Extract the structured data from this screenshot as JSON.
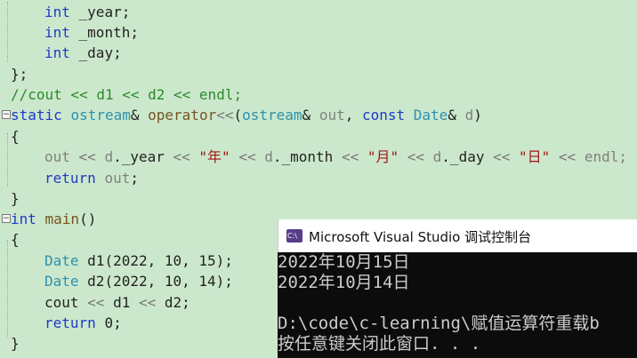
{
  "editor": {
    "lines": [
      {
        "id": "l1",
        "tokens": [
          {
            "c": "kw",
            "t": "int"
          },
          {
            "c": "pl",
            "t": " _year;"
          }
        ]
      },
      {
        "id": "l2",
        "tokens": [
          {
            "c": "kw",
            "t": "int"
          },
          {
            "c": "pl",
            "t": " _month;"
          }
        ]
      },
      {
        "id": "l3",
        "tokens": [
          {
            "c": "kw",
            "t": "int"
          },
          {
            "c": "pl",
            "t": " _day;"
          }
        ]
      },
      {
        "id": "l4",
        "tokens": [
          {
            "c": "pl",
            "t": "};"
          }
        ]
      },
      {
        "id": "l5",
        "tokens": [
          {
            "c": "cm",
            "t": "//cout << d1 << d2 << endl;"
          }
        ]
      },
      {
        "id": "l6",
        "tokens": [
          {
            "c": "kw",
            "t": "static "
          },
          {
            "c": "ty",
            "t": "ostream"
          },
          {
            "c": "pl",
            "t": "& "
          },
          {
            "c": "fn",
            "t": "operator"
          },
          {
            "c": "op",
            "t": "<<"
          },
          {
            "c": "pl",
            "t": "("
          },
          {
            "c": "ty",
            "t": "ostream"
          },
          {
            "c": "pl",
            "t": "& "
          },
          {
            "c": "pa",
            "t": "out"
          },
          {
            "c": "pl",
            "t": ", "
          },
          {
            "c": "kw",
            "t": "const "
          },
          {
            "c": "ty",
            "t": "Date"
          },
          {
            "c": "pl",
            "t": "& "
          },
          {
            "c": "pa",
            "t": "d"
          },
          {
            "c": "pl",
            "t": ")"
          }
        ]
      },
      {
        "id": "l7",
        "tokens": [
          {
            "c": "pl",
            "t": "{"
          }
        ]
      },
      {
        "id": "l8",
        "tokens": [
          {
            "c": "pa",
            "t": "out "
          },
          {
            "c": "op",
            "t": "<< "
          },
          {
            "c": "pa",
            "t": "d"
          },
          {
            "c": "pl",
            "t": "._year "
          },
          {
            "c": "op",
            "t": "<< "
          },
          {
            "c": "st",
            "t": "\"年\" "
          },
          {
            "c": "op",
            "t": "<< "
          },
          {
            "c": "pa",
            "t": "d"
          },
          {
            "c": "pl",
            "t": "._month "
          },
          {
            "c": "op",
            "t": "<< "
          },
          {
            "c": "st",
            "t": "\"月\" "
          },
          {
            "c": "op",
            "t": "<< "
          },
          {
            "c": "pa",
            "t": "d"
          },
          {
            "c": "pl",
            "t": "._day "
          },
          {
            "c": "op",
            "t": "<< "
          },
          {
            "c": "st",
            "t": "\"日\" "
          },
          {
            "c": "op",
            "t": "<< "
          },
          {
            "c": "pa",
            "t": "endl;"
          }
        ]
      },
      {
        "id": "l9",
        "tokens": [
          {
            "c": "kw",
            "t": "return "
          },
          {
            "c": "pa",
            "t": "out"
          },
          {
            "c": "pl",
            "t": ";"
          }
        ]
      },
      {
        "id": "l10",
        "tokens": [
          {
            "c": "pl",
            "t": "}"
          }
        ]
      },
      {
        "id": "l11",
        "tokens": [
          {
            "c": "kw",
            "t": "int "
          },
          {
            "c": "fn",
            "t": "main"
          },
          {
            "c": "pl",
            "t": "()"
          }
        ]
      },
      {
        "id": "l12",
        "tokens": [
          {
            "c": "pl",
            "t": "{"
          }
        ]
      },
      {
        "id": "l13",
        "tokens": [
          {
            "c": "ty",
            "t": "Date "
          },
          {
            "c": "pl",
            "t": "d1(2022, 10, 15);"
          }
        ]
      },
      {
        "id": "l14",
        "tokens": [
          {
            "c": "ty",
            "t": "Date "
          },
          {
            "c": "pl",
            "t": "d2(2022, 10, 14);"
          }
        ]
      },
      {
        "id": "l15",
        "tokens": [
          {
            "c": "pl",
            "t": "cout "
          },
          {
            "c": "op",
            "t": "<< "
          },
          {
            "c": "pl",
            "t": "d1 "
          },
          {
            "c": "op",
            "t": "<< "
          },
          {
            "c": "pl",
            "t": "d2;"
          }
        ]
      },
      {
        "id": "l16",
        "tokens": [
          {
            "c": "kw",
            "t": "return "
          },
          {
            "c": "pl",
            "t": "0;"
          }
        ]
      },
      {
        "id": "l17",
        "tokens": [
          {
            "c": "pl",
            "t": "}"
          }
        ]
      }
    ]
  },
  "console": {
    "title": "Microsoft Visual Studio 调试控制台",
    "icon_label": "C:\\",
    "lines": [
      "2022年10月15日",
      "2022年10月14日",
      "",
      "D:\\code\\c-learning\\赋值运算符重载b",
      "按任意键关闭此窗口. . ."
    ]
  }
}
